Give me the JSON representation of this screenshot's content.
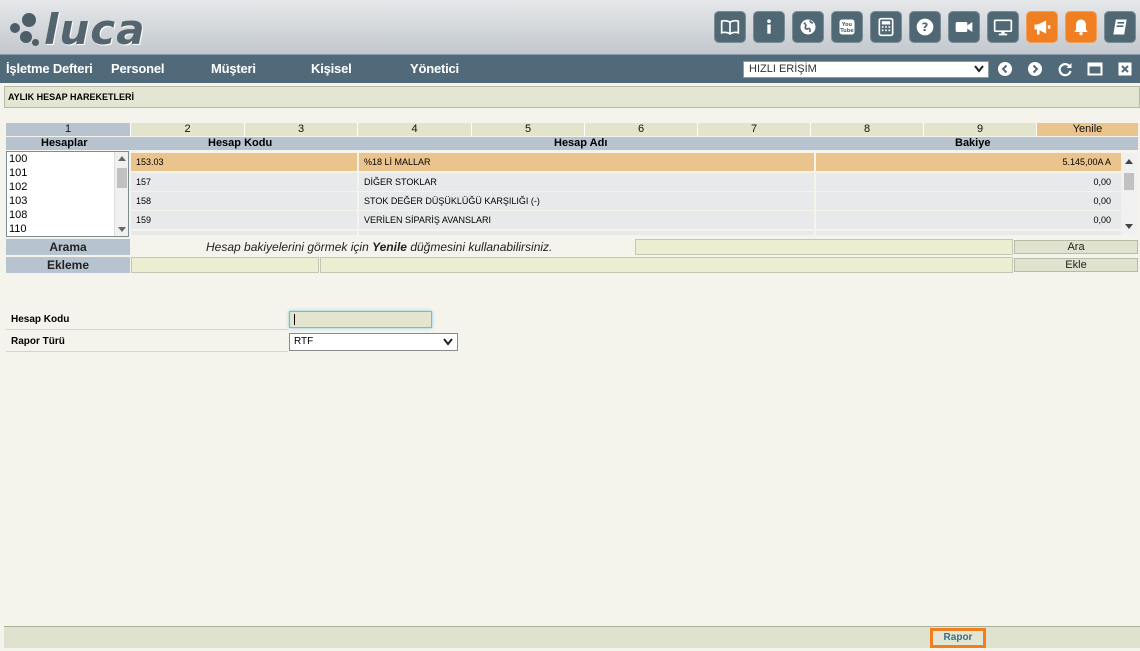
{
  "app": {
    "logo_text": "luca",
    "header_icons": [
      {
        "name": "manual-book-icon",
        "color": "#506774"
      },
      {
        "name": "info-icon",
        "color": "#506774"
      },
      {
        "name": "globe-icon",
        "color": "#506774"
      },
      {
        "name": "youtube-icon",
        "color": "#506774"
      },
      {
        "name": "calculator-icon",
        "color": "#506774"
      },
      {
        "name": "help-icon",
        "color": "#506774"
      },
      {
        "name": "video-camera-icon",
        "color": "#506774"
      },
      {
        "name": "monitor-icon",
        "color": "#506774"
      },
      {
        "name": "megaphone-icon",
        "color": "#f07f22"
      },
      {
        "name": "bell-icon",
        "color": "#f07f22"
      },
      {
        "name": "notebook-icon",
        "color": "#506774"
      }
    ]
  },
  "nav": {
    "items": [
      "İşletme Defteri",
      "Personel",
      "Müşteri",
      "Kişisel",
      "Yönetici"
    ],
    "quick_access": "HIZLI ERİŞİM"
  },
  "page": {
    "title": "AYLIK HESAP HAREKETLERİ"
  },
  "grid": {
    "column_numbers": [
      "1",
      "2",
      "3",
      "4",
      "5",
      "6",
      "7",
      "8",
      "9"
    ],
    "refresh_label": "Yenile",
    "headers": {
      "accounts": "Hesaplar",
      "code": "Hesap Kodu",
      "name": "Hesap Adı",
      "balance": "Bakiye"
    },
    "account_list": [
      "100",
      "101",
      "102",
      "103",
      "108",
      "110"
    ],
    "rows": [
      {
        "code": "153.03",
        "name": "%18 Lİ MALLAR",
        "balance": "5.145,00A A",
        "selected": true
      },
      {
        "code": "157",
        "name": "DİĞER STOKLAR",
        "balance": "0,00",
        "selected": false
      },
      {
        "code": "158",
        "name": "STOK DEĞER DÜŞÜKLÜĞÜ KARŞILIĞI (-)",
        "balance": "0,00",
        "selected": false
      },
      {
        "code": "159",
        "name": "VERİLEN SİPARİŞ AVANSLARI",
        "balance": "0,00",
        "selected": false
      }
    ]
  },
  "search": {
    "label": "Arama",
    "hint_pre": "Hesap bakiyelerini görmek için ",
    "hint_bold": "Yenile",
    "hint_post": " düğmesini kullanabilirsiniz.",
    "button": "Ara"
  },
  "add": {
    "label": "Ekleme",
    "button": "Ekle"
  },
  "form": {
    "account_code_label": "Hesap Kodu",
    "account_code_value": "",
    "report_type_label": "Rapor Türü",
    "report_type_value": "RTF"
  },
  "footer": {
    "report_button": "Rapor",
    "highlight_color": "#f07f22"
  }
}
